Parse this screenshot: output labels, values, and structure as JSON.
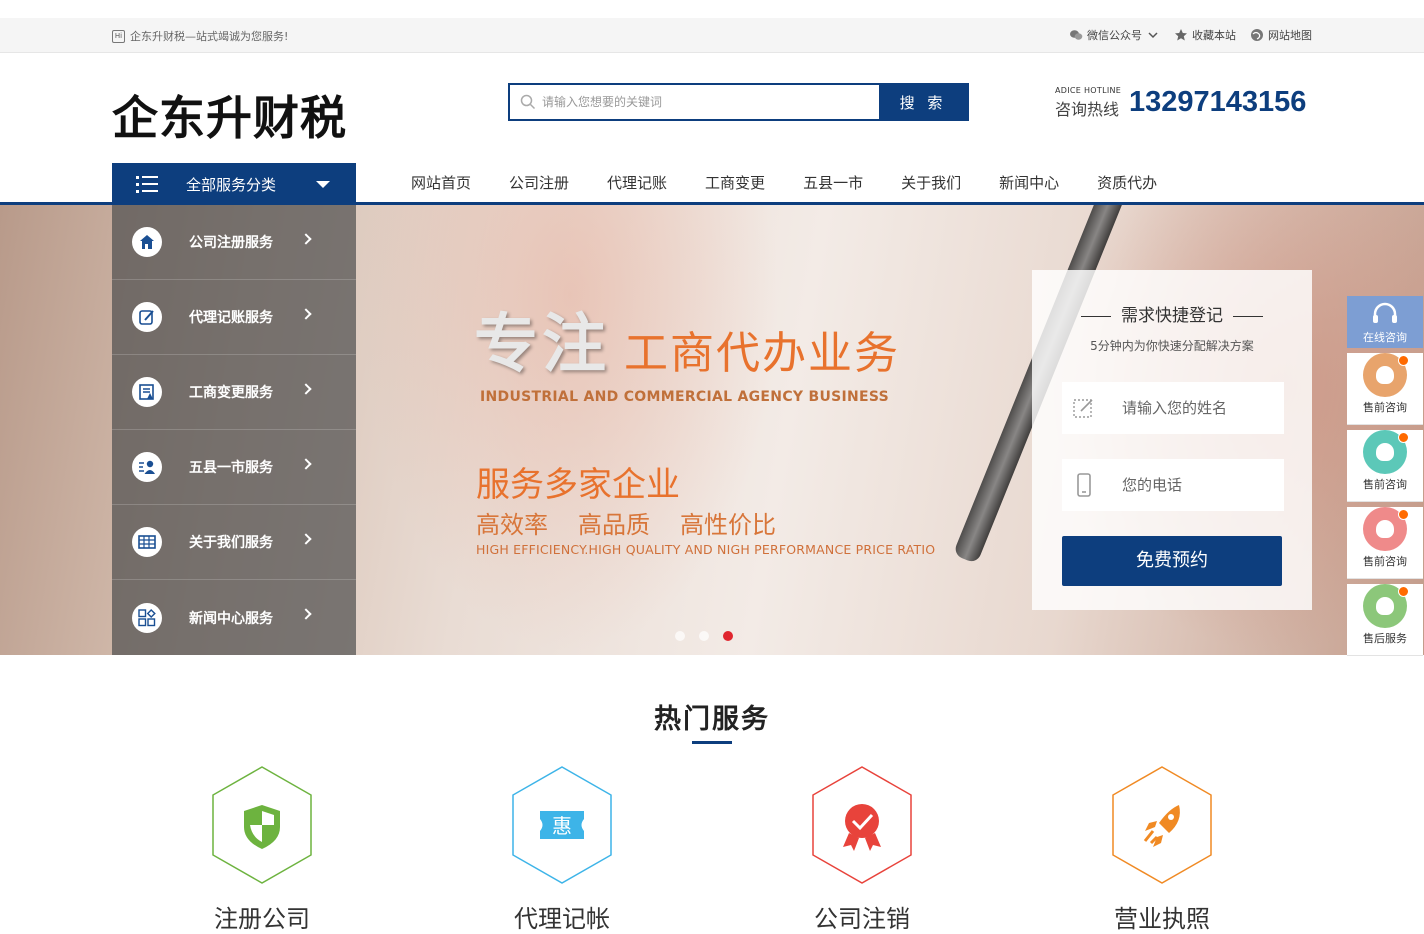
{
  "topbar": {
    "welcome": "企东升财税—站式竭诚为您服务!",
    "links": [
      "微信公众号",
      "收藏本站",
      "网站地图"
    ]
  },
  "header": {
    "logo": "企东升财税",
    "search_placeholder": "请输入您想要的关键词",
    "search_button": "搜 索",
    "hotline_en": "ADICE HOTLINE",
    "hotline_cn": "咨询热线",
    "hotline_number": "13297143156"
  },
  "nav": {
    "all_categories": "全部服务分类",
    "items": [
      "网站首页",
      "公司注册",
      "代理记账",
      "工商变更",
      "五县一市",
      "关于我们",
      "新闻中心",
      "资质代办"
    ]
  },
  "side_menu": [
    {
      "label": "公司注册服务",
      "icon": "building-icon"
    },
    {
      "label": "代理记账服务",
      "icon": "edit-icon"
    },
    {
      "label": "工商变更服务",
      "icon": "document-icon"
    },
    {
      "label": "五县一市服务",
      "icon": "user-list-icon"
    },
    {
      "label": "关于我们服务",
      "icon": "table-icon"
    },
    {
      "label": "新闻中心服务",
      "icon": "grid-icon"
    }
  ],
  "banner": {
    "title_big": "专注",
    "title_sub": "工商代办业务",
    "title_en": "INDUSTRIAL AND COMMERCIAL AGENCY BUSINESS",
    "heading": "服务多家企业",
    "features": [
      "高效率",
      "高品质",
      "高性价比"
    ],
    "features_en": "HIGH EFFICIENCY.HIGH QUALITY AND NIGH PERFORMANCE PRICE RATIO",
    "slide_count": 3,
    "active_slide": 3
  },
  "quick_form": {
    "title": "需求快捷登记",
    "hint": "5分钟内为你快速分配解决方案",
    "name_placeholder": "请输入您的姓名",
    "phone_placeholder": "您的电话",
    "submit": "免费预约"
  },
  "float_service": {
    "online": "在线咨询",
    "agents": [
      {
        "label": "售前咨询",
        "color": "#e8a46c"
      },
      {
        "label": "售前咨询",
        "color": "#5cc8b8"
      },
      {
        "label": "售前咨询",
        "color": "#ef8a8a"
      },
      {
        "label": "售后服务",
        "color": "#8cc77a"
      }
    ]
  },
  "hot_services": {
    "title": "热门服务",
    "items": [
      {
        "label": "注册公司",
        "icon": "shield-icon",
        "color": "#6db33f"
      },
      {
        "label": "代理记帐",
        "icon": "discount-icon",
        "color": "#3db4e8"
      },
      {
        "label": "公司注销",
        "icon": "badge-icon",
        "color": "#e8433b"
      },
      {
        "label": "营业执照",
        "icon": "rocket-icon",
        "color": "#f08a24"
      }
    ]
  }
}
